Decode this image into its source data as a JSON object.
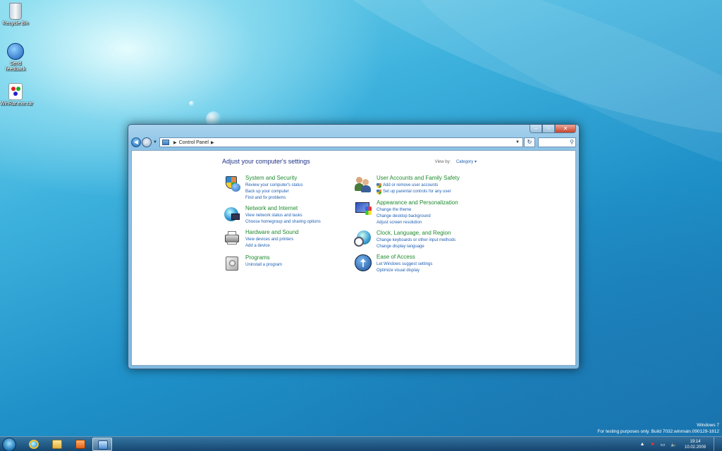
{
  "desktop": {
    "icons": [
      {
        "label": "Recycle Bin",
        "icon": "recycle-bin-icon"
      },
      {
        "label": "Send feedback",
        "icon": "send-feedback-icon"
      },
      {
        "label": "WinRar.exe.rar",
        "icon": "winrar-icon"
      }
    ]
  },
  "window": {
    "controls": {
      "minimize": "–",
      "maximize": "▫",
      "close": "✕"
    },
    "address": {
      "path": "Control Panel"
    },
    "search": {
      "placeholder": ""
    },
    "content": {
      "title": "Adjust your computer's settings",
      "view_by_label": "View by:",
      "view_by_value": "Category",
      "categories_left": [
        {
          "name": "System and Security",
          "icon": "shield-flag-icon",
          "links": [
            "Review your computer's status",
            "Back up your computer",
            "Find and fix problems"
          ]
        },
        {
          "name": "Network and Internet",
          "icon": "globe-network-icon",
          "links": [
            "View network status and tasks",
            "Choose homegroup and sharing options"
          ]
        },
        {
          "name": "Hardware and Sound",
          "icon": "printer-icon",
          "links": [
            "View devices and printers",
            "Add a device"
          ]
        },
        {
          "name": "Programs",
          "icon": "programs-icon",
          "links": [
            "Uninstall a program"
          ]
        }
      ],
      "categories_right": [
        {
          "name": "User Accounts and Family Safety",
          "icon": "users-icon",
          "links": [
            "Add or remove user accounts",
            "Set up parental controls for any user"
          ]
        },
        {
          "name": "Appearance and Personalization",
          "icon": "display-paint-icon",
          "links": [
            "Change the theme",
            "Change desktop background",
            "Adjust screen resolution"
          ]
        },
        {
          "name": "Clock, Language, and Region",
          "icon": "clock-globe-icon",
          "links": [
            "Change keyboards or other input methods",
            "Change display language"
          ]
        },
        {
          "name": "Ease of Access",
          "icon": "ease-of-access-icon",
          "links": [
            "Let Windows suggest settings",
            "Optimize visual display"
          ]
        }
      ]
    }
  },
  "taskbar": {
    "pinned": [
      "internet-explorer-icon",
      "windows-explorer-icon",
      "media-player-icon",
      "control-panel-icon"
    ],
    "clock_time": "19:14",
    "clock_date": "10.02.2009"
  },
  "watermark": {
    "line1": "Windows 7",
    "line2": "For testing purposes only. Build 7032.winmain.090129-1812"
  },
  "colors": {
    "category_heading": "#1e8b2e",
    "link": "#1e5fb4",
    "title": "#1e3287"
  }
}
